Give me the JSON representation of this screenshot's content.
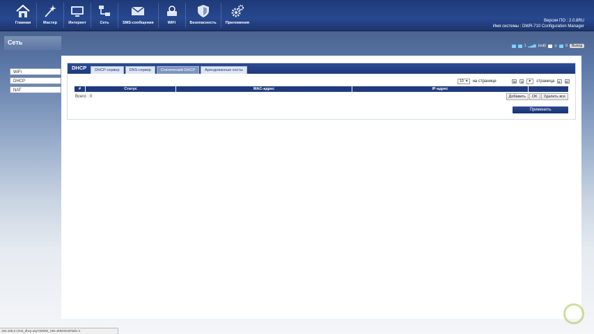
{
  "nav": {
    "items": [
      {
        "label": "Главная",
        "icon": "home-icon"
      },
      {
        "label": "Мастер",
        "icon": "wizard-icon"
      },
      {
        "label": "Интернет",
        "icon": "internet-icon"
      },
      {
        "label": "Сеть",
        "icon": "network-icon"
      },
      {
        "label": "SMS-сообщения",
        "icon": "sms-icon"
      },
      {
        "label": "WiFi",
        "icon": "wifi-icon"
      },
      {
        "label": "Безопасность",
        "icon": "security-icon"
      },
      {
        "label": "Приложения",
        "icon": "applications-icon"
      }
    ]
  },
  "sysinfo": {
    "fw": "Версия ПО : 2.0.8RU",
    "system_name": "Имя системы : DWR-710 Configuration Manager"
  },
  "sidebar": {
    "title": "Сеть",
    "items": [
      {
        "label": "WiFi"
      },
      {
        "label": "DHCP"
      },
      {
        "label": "NAT"
      }
    ]
  },
  "status": {
    "count": "1",
    "network": "(null)",
    "messages": "0",
    "logout": "Выход"
  },
  "panel": {
    "heading": "DHCP",
    "tabs": [
      {
        "label": "DHCP-сервер",
        "active": false
      },
      {
        "label": "DNS-сервер",
        "active": false
      },
      {
        "label": "Статический DHCP",
        "active": true
      },
      {
        "label": "Арендованные хосты",
        "active": false
      }
    ],
    "per_page_value": "10",
    "per_page_label": "на странице",
    "page_label": "страница",
    "table_headers": [
      "#",
      "Статус",
      "MAC-адрес",
      "IP-адрес",
      ""
    ],
    "total": "Всего : 0",
    "buttons": {
      "add": "Добавить",
      "ok": "OK",
      "delete_all": "Удалить все"
    },
    "apply": "Применить"
  },
  "statusbar": {
    "url": "192.168.0.1/net_dhcp.asp?WWW_SID=80D0519#tabs-4"
  },
  "colors": {
    "navbar": "#1e3a78",
    "accent": "#1e3a7d",
    "active_tab": "#7f95c3"
  }
}
